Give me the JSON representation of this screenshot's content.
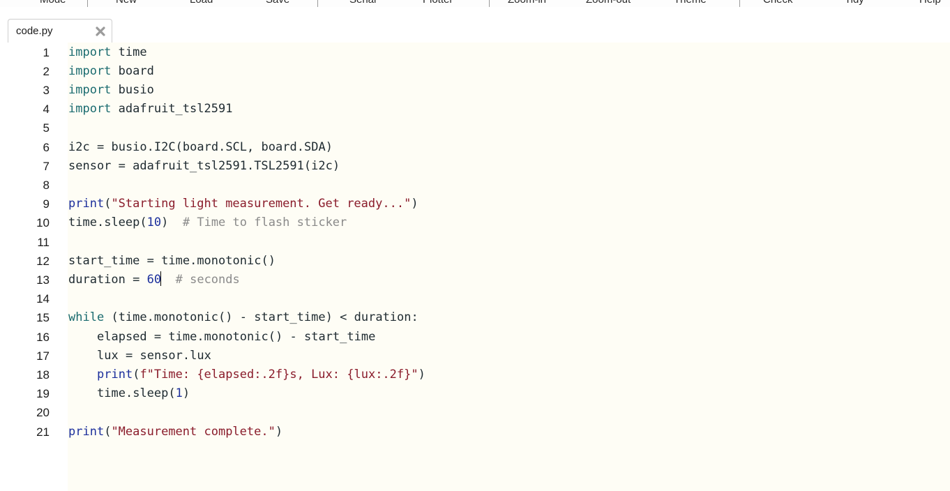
{
  "toolbar": {
    "items": [
      "Mode",
      "New",
      "Load",
      "Save",
      "Serial",
      "Plotter",
      "Zoom-in",
      "Zoom-out",
      "Theme",
      "Check",
      "Tidy",
      "Help"
    ]
  },
  "tabs": [
    {
      "label": "code.py",
      "close_icon": "close-x-icon"
    }
  ],
  "editor": {
    "line_numbers": [
      "1",
      "2",
      "3",
      "4",
      "5",
      "6",
      "7",
      "8",
      "9",
      "10",
      "11",
      "12",
      "13",
      "14",
      "15",
      "16",
      "17",
      "18",
      "19",
      "20",
      "21"
    ],
    "cursor": {
      "line": 13,
      "after_text": "duration = 60"
    },
    "code_lines": [
      "import time",
      "import board",
      "import busio",
      "import adafruit_tsl2591",
      "",
      "i2c = busio.I2C(board.SCL, board.SDA)",
      "sensor = adafruit_tsl2591.TSL2591(i2c)",
      "",
      "print(\"Starting light measurement. Get ready...\")",
      "time.sleep(10)  # Time to flash sticker",
      "",
      "start_time = time.monotonic()",
      "duration = 60  # seconds",
      "",
      "while (time.monotonic() - start_time) < duration:",
      "    elapsed = time.monotonic() - start_time",
      "    lux = sensor.lux",
      "    print(f\"Time: {elapsed:.2f}s, Lux: {lux:.2f}\")",
      "    time.sleep(1)",
      "",
      "print(\"Measurement complete.\")"
    ],
    "colors": {
      "background": "#fefdf5",
      "keyword": "#1a6b6f",
      "builtin": "#1c2f9c",
      "string": "#8a1c2b",
      "number": "#1c2f9c",
      "comment": "#8a8a8a",
      "default": "#1e2a30"
    }
  }
}
